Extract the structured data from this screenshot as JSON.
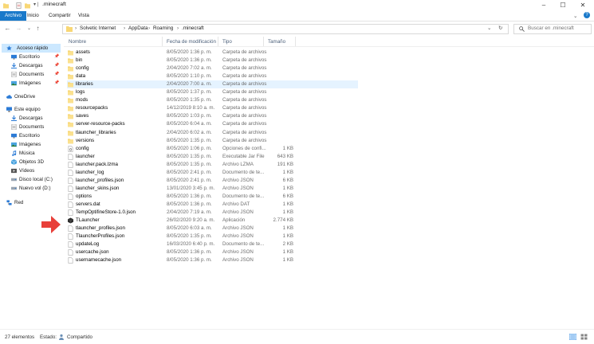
{
  "window": {
    "title": ".minecraft"
  },
  "ribbon": {
    "tabs": [
      "Archivo",
      "Inicio",
      "Compartir",
      "Vista"
    ]
  },
  "address": {
    "crumbs": [
      "Solvetic Internet",
      "AppData",
      "Roaming",
      ".minecraft"
    ]
  },
  "search": {
    "placeholder": "Buscar en .minecraft"
  },
  "sidebar": {
    "items": [
      {
        "label": "Acceso rápido",
        "icon": "star-icon",
        "selected": true
      },
      {
        "label": "Escritorio",
        "icon": "desktop-icon",
        "pinned": true
      },
      {
        "label": "Descargas",
        "icon": "download-icon",
        "pinned": true
      },
      {
        "label": "Documents",
        "icon": "documents-icon",
        "pinned": true
      },
      {
        "label": "Imágenes",
        "icon": "pictures-icon",
        "pinned": true
      },
      {
        "label": "OneDrive",
        "icon": "cloud-icon"
      },
      {
        "label": "Este equipo",
        "icon": "computer-icon"
      },
      {
        "label": "Descargas",
        "icon": "download-icon"
      },
      {
        "label": "Documents",
        "icon": "documents-icon"
      },
      {
        "label": "Escritorio",
        "icon": "desktop-icon"
      },
      {
        "label": "Imágenes",
        "icon": "pictures-icon"
      },
      {
        "label": "Música",
        "icon": "music-icon"
      },
      {
        "label": "Objetos 3D",
        "icon": "cube-icon"
      },
      {
        "label": "Vídeos",
        "icon": "video-icon"
      },
      {
        "label": "Disco local (C:)",
        "icon": "drive-icon"
      },
      {
        "label": "Nuevo vol (D:)",
        "icon": "drive-icon"
      },
      {
        "label": "Red",
        "icon": "network-icon"
      }
    ]
  },
  "columns": {
    "name": "Nombre",
    "date": "Fecha de modificación",
    "type": "Tipo",
    "size": "Tamaño"
  },
  "files": [
    {
      "name": "assets",
      "date": "8/05/2020 1:36 p. m.",
      "type": "Carpeta de archivos",
      "size": "",
      "kind": "folder"
    },
    {
      "name": "bin",
      "date": "8/05/2020 1:36 p. m.",
      "type": "Carpeta de archivos",
      "size": "",
      "kind": "folder"
    },
    {
      "name": "config",
      "date": "2/04/2020 7:02 a. m.",
      "type": "Carpeta de archivos",
      "size": "",
      "kind": "folder"
    },
    {
      "name": "data",
      "date": "8/05/2020 1:10 p. m.",
      "type": "Carpeta de archivos",
      "size": "",
      "kind": "folder"
    },
    {
      "name": "libraries",
      "date": "2/04/2020 7:00 a. m.",
      "type": "Carpeta de archivos",
      "size": "",
      "kind": "folder",
      "highlight": true
    },
    {
      "name": "logs",
      "date": "8/05/2020 1:37 p. m.",
      "type": "Carpeta de archivos",
      "size": "",
      "kind": "folder"
    },
    {
      "name": "mods",
      "date": "8/05/2020 1:35 p. m.",
      "type": "Carpeta de archivos",
      "size": "",
      "kind": "folder"
    },
    {
      "name": "resourcepacks",
      "date": "14/12/2019 8:10 a. m.",
      "type": "Carpeta de archivos",
      "size": "",
      "kind": "folder"
    },
    {
      "name": "saves",
      "date": "8/05/2020 1:03 p. m.",
      "type": "Carpeta de archivos",
      "size": "",
      "kind": "folder"
    },
    {
      "name": "server-resource-packs",
      "date": "8/05/2020 6:04 a. m.",
      "type": "Carpeta de archivos",
      "size": "",
      "kind": "folder"
    },
    {
      "name": "tlauncher_libraries",
      "date": "2/04/2020 6:02 a. m.",
      "type": "Carpeta de archivos",
      "size": "",
      "kind": "folder"
    },
    {
      "name": "versions",
      "date": "8/05/2020 1:35 p. m.",
      "type": "Carpeta de archivos",
      "size": "",
      "kind": "folder"
    },
    {
      "name": "config",
      "date": "8/05/2020 1:06 p. m.",
      "type": "Opciones de confi...",
      "size": "1 KB",
      "kind": "config"
    },
    {
      "name": "launcher",
      "date": "8/05/2020 1:35 p. m.",
      "type": "Executable Jar File",
      "size": "643 KB",
      "kind": "file"
    },
    {
      "name": "launcher.pack.lzma",
      "date": "8/05/2020 1:35 p. m.",
      "type": "Archivo LZMA",
      "size": "191 KB",
      "kind": "file"
    },
    {
      "name": "launcher_log",
      "date": "8/05/2020 2:41 p. m.",
      "type": "Documento de te...",
      "size": "1 KB",
      "kind": "file"
    },
    {
      "name": "launcher_profiles.json",
      "date": "8/05/2020 2:41 p. m.",
      "type": "Archivo JSON",
      "size": "6 KB",
      "kind": "file"
    },
    {
      "name": "launcher_skins.json",
      "date": "13/01/2020 3:45 p. m.",
      "type": "Archivo JSON",
      "size": "1 KB",
      "kind": "file"
    },
    {
      "name": "options",
      "date": "8/05/2020 1:36 p. m.",
      "type": "Documento de te...",
      "size": "6 KB",
      "kind": "file"
    },
    {
      "name": "servers.dat",
      "date": "8/05/2020 1:36 p. m.",
      "type": "Archivo DAT",
      "size": "1 KB",
      "kind": "file"
    },
    {
      "name": "TempOptifineStore-1.0.json",
      "date": "2/04/2020 7:19 a. m.",
      "type": "Archivo JSON",
      "size": "1 KB",
      "kind": "file"
    },
    {
      "name": "TLauncher",
      "date": "26/02/2020 9:20 a. m.",
      "type": "Aplicación",
      "size": "2.774 KB",
      "kind": "app"
    },
    {
      "name": "tlauncher_profiles.json",
      "date": "8/05/2020 6:03 a. m.",
      "type": "Archivo JSON",
      "size": "1 KB",
      "kind": "file"
    },
    {
      "name": "TlauncherProfiles.json",
      "date": "8/05/2020 1:35 p. m.",
      "type": "Archivo JSON",
      "size": "1 KB",
      "kind": "file"
    },
    {
      "name": "updateLog",
      "date": "16/03/2020 6:40 p. m.",
      "type": "Documento de te...",
      "size": "2 KB",
      "kind": "file"
    },
    {
      "name": "usercache.json",
      "date": "8/05/2020 1:36 p. m.",
      "type": "Archivo JSON",
      "size": "1 KB",
      "kind": "file"
    },
    {
      "name": "usernamecache.json",
      "date": "8/05/2020 1:36 p. m.",
      "type": "Archivo JSON",
      "size": "1 KB",
      "kind": "file"
    }
  ],
  "status": {
    "count": "27 elementos",
    "state_label": "Estado:",
    "state_value": "Compartido"
  },
  "colors": {
    "accent": "#1979ca",
    "folder": "#f8d775",
    "arrow": "#e8403a",
    "selection": "#cce8ff"
  }
}
